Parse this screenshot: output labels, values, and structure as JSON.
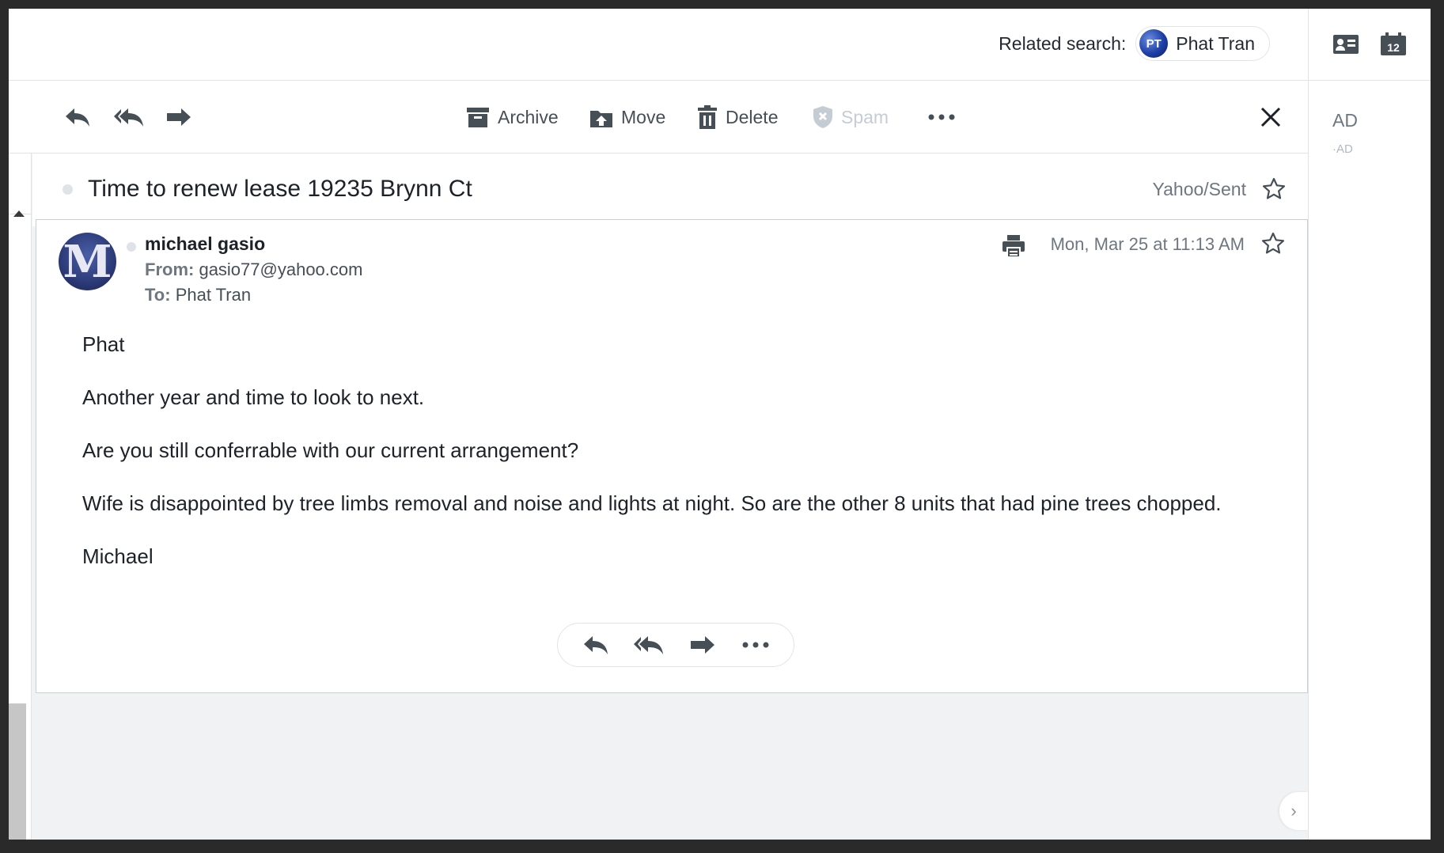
{
  "header": {
    "related_label": "Related search:",
    "related_name": "Phat Tran",
    "related_avatar_initials": "PT"
  },
  "right_rail": {
    "icons": [
      "contact-card-icon",
      "calendar-icon"
    ],
    "calendar_day": "12",
    "ad_label": "AD",
    "ad_sub": "·AD"
  },
  "toolbar": {
    "archive": "Archive",
    "move": "Move",
    "delete": "Delete",
    "spam": "Spam",
    "icons": [
      "reply-icon",
      "reply-all-icon",
      "forward-icon",
      "archive-icon",
      "move-icon",
      "delete-icon",
      "spam-icon",
      "more-icon",
      "close-icon"
    ]
  },
  "subject": {
    "text": "Time to renew lease 19235 Brynn Ct",
    "folder": "Yahoo/Sent"
  },
  "message": {
    "avatar_letter": "M",
    "sender_name": "michael gasio",
    "from_label": "From:",
    "from_value": "gasio77@yahoo.com",
    "to_label": "To:",
    "to_value": "Phat Tran",
    "date": "Mon, Mar 25 at 11:13 AM",
    "body": [
      "Phat",
      "Another year and time to look to next.",
      "Are you still conferrable with our current arrangement?",
      "Wife is disappointed by tree limbs removal and noise and lights at night. So are the other 8 units that had pine trees chopped.",
      "Michael"
    ]
  },
  "colors": {
    "icon": "#464e56",
    "disabled": "#c5ccd3",
    "muted_text": "#6e7780",
    "border": "#e0e4e9"
  }
}
